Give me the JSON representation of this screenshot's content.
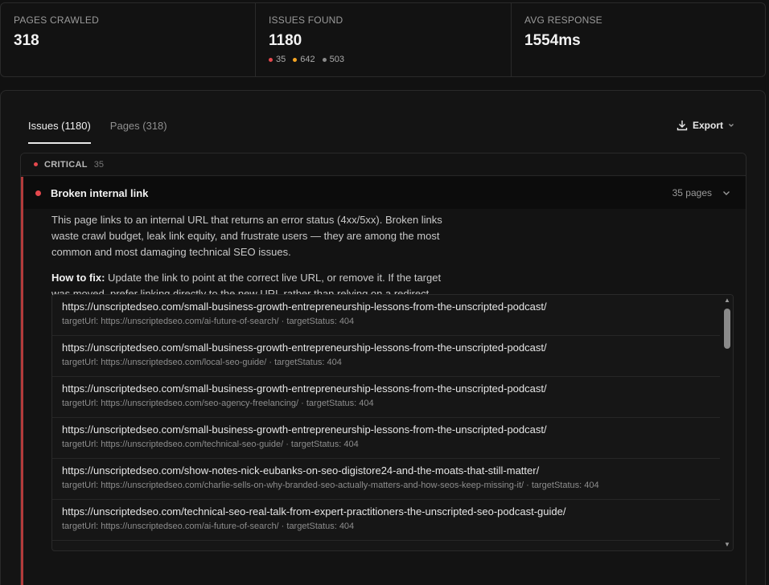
{
  "stats": [
    {
      "label": "PAGES CRAWLED",
      "value": "318"
    },
    {
      "label": "ISSUES FOUND",
      "value": "1180",
      "breakdown": [
        {
          "count": "35",
          "color": "#e5484d"
        },
        {
          "count": "642",
          "color": "#f5a524"
        },
        {
          "count": "503",
          "color": "#8a8a8a"
        }
      ]
    },
    {
      "label": "AVG RESPONSE",
      "value": "1554ms"
    }
  ],
  "tabs": [
    {
      "label": "Issues (1180)",
      "active": true
    },
    {
      "label": "Pages (318)",
      "active": false
    }
  ],
  "export": {
    "label": "Export",
    "icon": "download-icon"
  },
  "severity_group": {
    "label": "CRITICAL",
    "count": "35",
    "color": "#e5484d"
  },
  "issue": {
    "title": "Broken internal link",
    "pages": "35 pages",
    "description": "This page links to an internal URL that returns an error status (4xx/5xx). Broken links waste crawl budget, leak link equity, and frustrate users — they are among the most common and most damaging technical SEO issues.",
    "howto_label": "How to fix:",
    "howto_text": " Update the link to point at the correct live URL, or remove it. If the target was moved, prefer linking directly to the new URL rather than relying on a redirect."
  },
  "urls": [
    {
      "url": "https://unscriptedseo.com/small-business-growth-entrepreneurship-lessons-from-the-unscripted-podcast/",
      "detail": "targetUrl: https://unscriptedseo.com/ai-future-of-search/ · targetStatus: 404"
    },
    {
      "url": "https://unscriptedseo.com/small-business-growth-entrepreneurship-lessons-from-the-unscripted-podcast/",
      "detail": "targetUrl: https://unscriptedseo.com/local-seo-guide/ · targetStatus: 404"
    },
    {
      "url": "https://unscriptedseo.com/small-business-growth-entrepreneurship-lessons-from-the-unscripted-podcast/",
      "detail": "targetUrl: https://unscriptedseo.com/seo-agency-freelancing/ · targetStatus: 404"
    },
    {
      "url": "https://unscriptedseo.com/small-business-growth-entrepreneurship-lessons-from-the-unscripted-podcast/",
      "detail": "targetUrl: https://unscriptedseo.com/technical-seo-guide/ · targetStatus: 404"
    },
    {
      "url": "https://unscriptedseo.com/show-notes-nick-eubanks-on-seo-digistore24-and-the-moats-that-still-matter/",
      "detail": "targetUrl: https://unscriptedseo.com/charlie-sells-on-why-branded-seo-actually-matters-and-how-seos-keep-missing-it/ · targetStatus: 404"
    },
    {
      "url": "https://unscriptedseo.com/technical-seo-real-talk-from-expert-practitioners-the-unscripted-seo-podcast-guide/",
      "detail": "targetUrl: https://unscriptedseo.com/ai-future-of-search/ · targetStatus: 404"
    }
  ]
}
